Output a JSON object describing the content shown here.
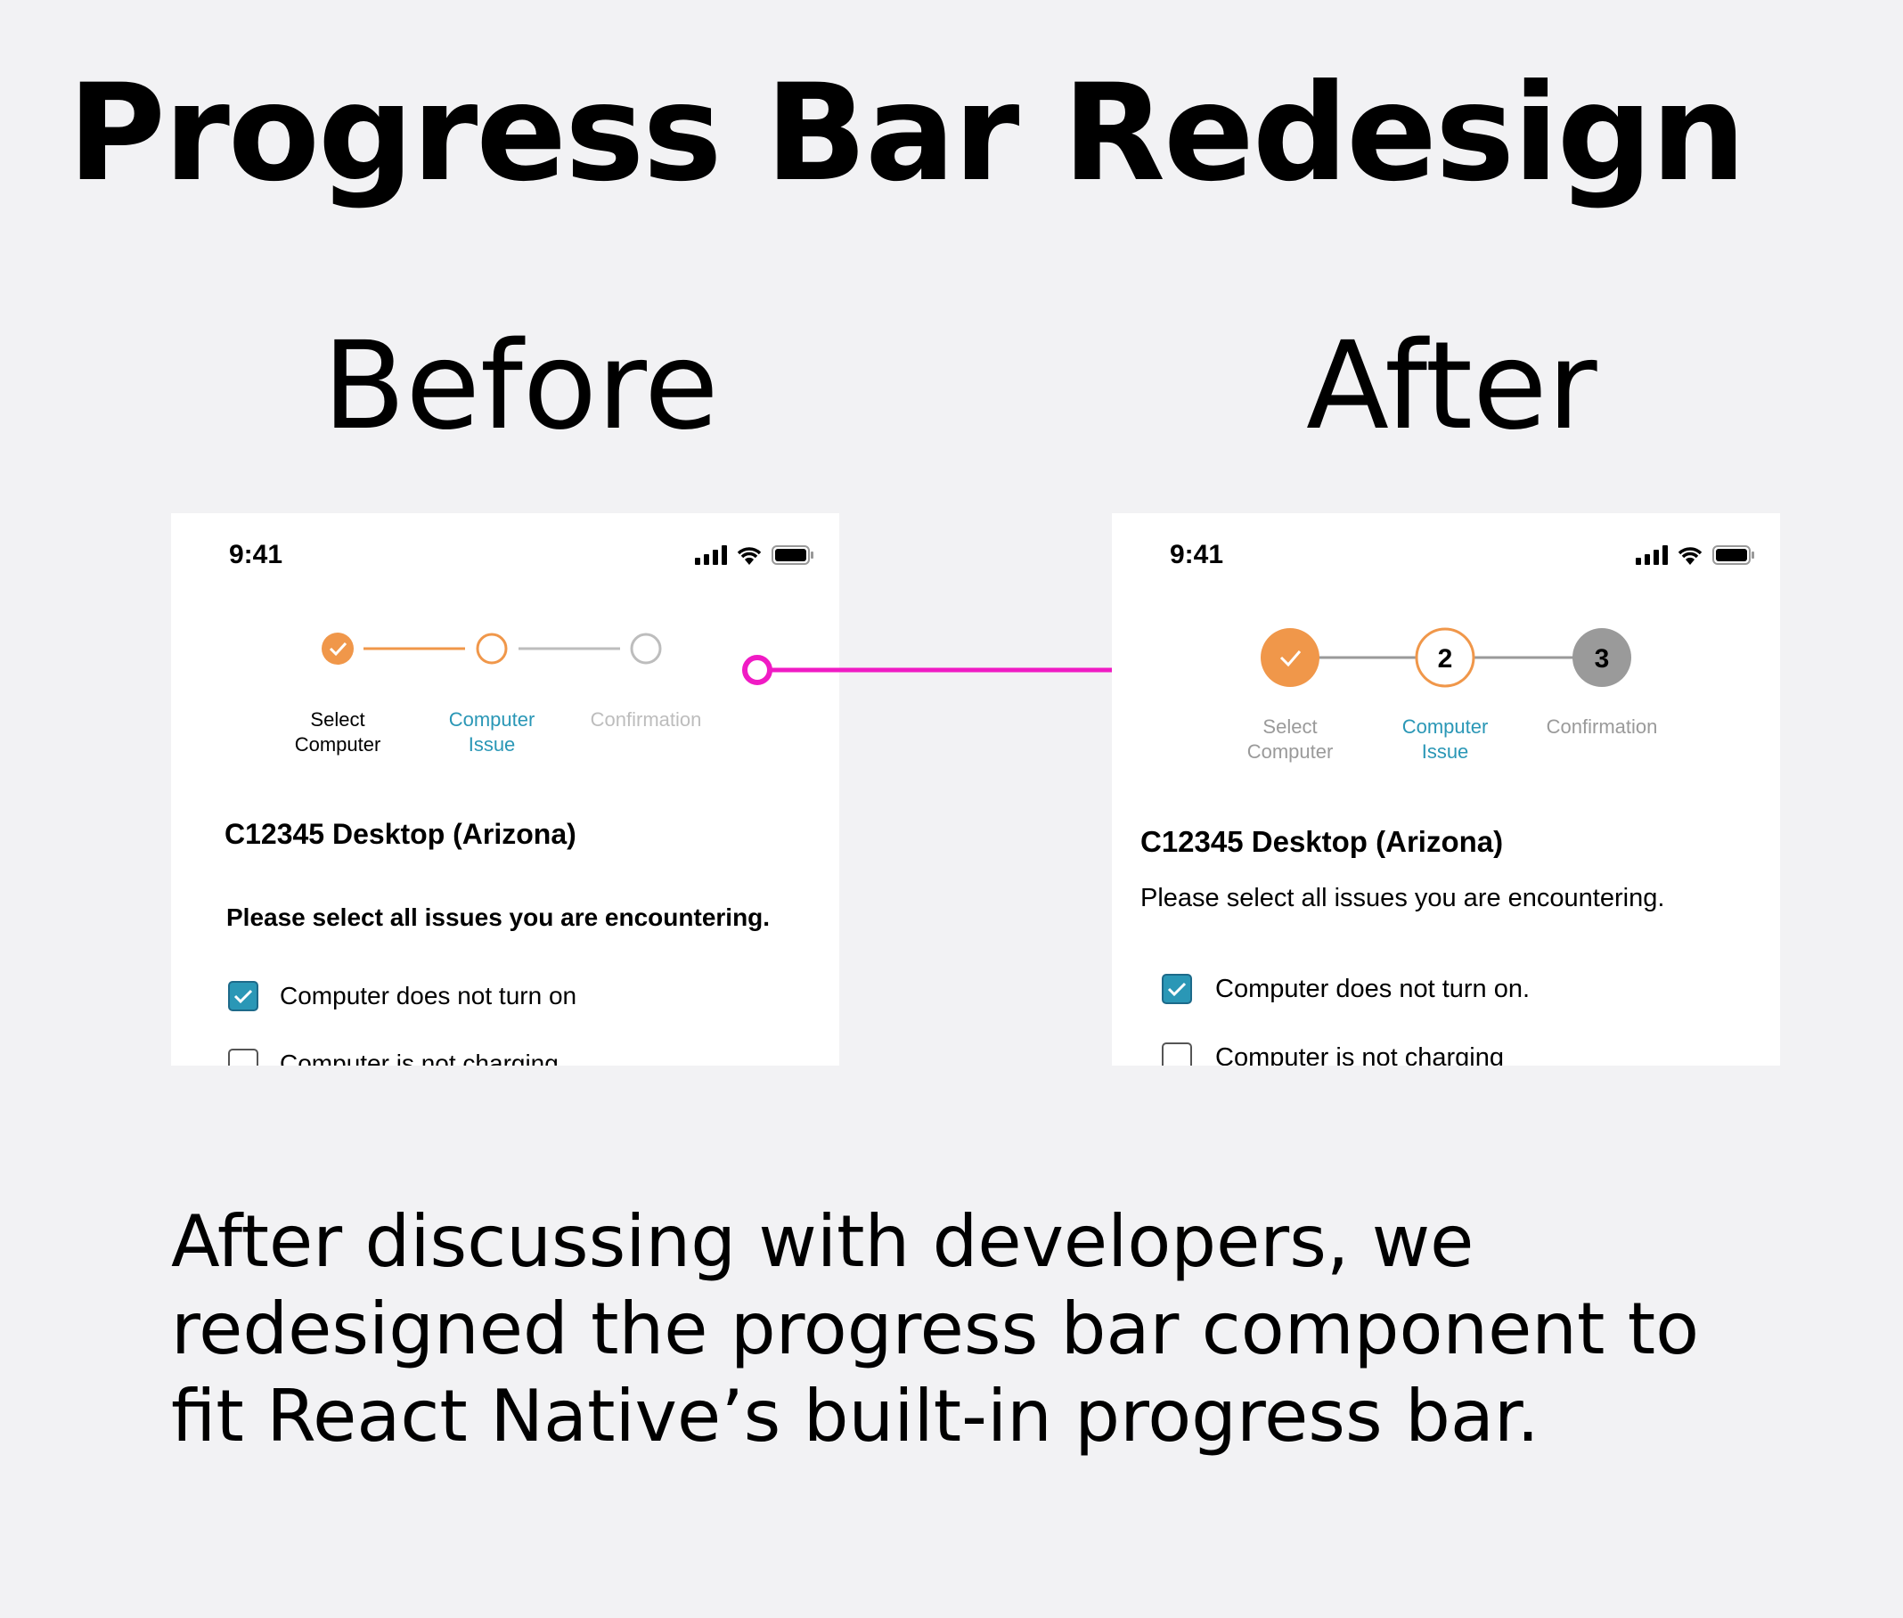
{
  "title": "Progress Bar Redesign",
  "before_label": "Before",
  "after_label": "After",
  "status_time": "9:41",
  "steps": [
    "Select Computer",
    "Computer Issue",
    "Confirmation"
  ],
  "step_lines": [
    [
      "Select",
      "Computer"
    ],
    [
      "Computer",
      "Issue"
    ],
    [
      "Confirmation"
    ]
  ],
  "step_numbers": [
    "2",
    "3"
  ],
  "computer_heading": "C12345 Desktop (Arizona)",
  "prompt": "Please select all issues you are encountering.",
  "before_issues": [
    "Computer does not turn on",
    "Computer is not charging"
  ],
  "after_issues": [
    "Computer does not turn on.",
    "Computer is not charging"
  ],
  "caption": "After discussing with developers, we redesigned the progress bar component to fit React Native’s built-in progress bar.",
  "colors": {
    "completed": "#f0974a",
    "current_text": "#2a97b6",
    "inactive": "#bdbdbd",
    "after_inactive_circle": "#9a9a9a",
    "arrow": "#f01bc4",
    "checkbox": "#2a97b6"
  }
}
